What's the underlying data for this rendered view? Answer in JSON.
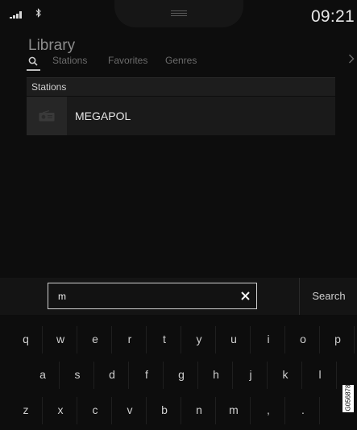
{
  "status_bar": {
    "time": "09:21",
    "signal_icon": "signal-bars-icon",
    "bluetooth_icon": "bluetooth-icon"
  },
  "header": {
    "title": "Library",
    "tabs": [
      {
        "label": "Stations"
      },
      {
        "label": "Favorites"
      },
      {
        "label": "Genres"
      }
    ],
    "search_tab_icon": "search-icon",
    "next_icon": "chevron-right-icon"
  },
  "results": {
    "section_title": "Stations",
    "items": [
      {
        "name": "MEGAPOL",
        "icon": "radio-icon"
      }
    ]
  },
  "search": {
    "value": "m",
    "clear_icon": "close-icon",
    "button_label": "Search"
  },
  "keyboard": {
    "rows": [
      [
        "q",
        "w",
        "e",
        "r",
        "t",
        "y",
        "u",
        "i",
        "o",
        "p"
      ],
      [
        "a",
        "s",
        "d",
        "f",
        "g",
        "h",
        "j",
        "k",
        "l"
      ],
      [
        "z",
        "x",
        "c",
        "v",
        "b",
        "n",
        "m",
        ",",
        "."
      ]
    ]
  },
  "image_code": "G056878",
  "colors": {
    "background": "#0d0d0d",
    "text_primary": "#e6e6e6",
    "text_muted": "#6c6c6c"
  }
}
